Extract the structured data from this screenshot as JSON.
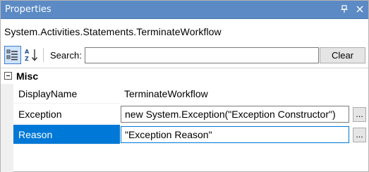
{
  "titlebar": {
    "title": "Properties",
    "pin_icon": "pin-icon",
    "close_icon": "close-icon"
  },
  "type_label": "System.Activities.Statements.TerminateWorkflow",
  "toolbar": {
    "categorized_icon": "categorized-view-icon",
    "alphabetical_icon": "sort-alphabetical-icon",
    "search_label": "Search:",
    "search_value": "",
    "clear_label": "Clear"
  },
  "grid": {
    "category": "Misc",
    "properties": [
      {
        "name": "DisplayName",
        "value": "TerminateWorkflow"
      },
      {
        "name": "Exception",
        "value": "new System.Exception(\"Exception Constructor\")",
        "ellipsis": "..."
      },
      {
        "name": "Reason",
        "value": "\"Exception Reason\"",
        "ellipsis": "..."
      }
    ],
    "selected_property": "Reason"
  },
  "colors": {
    "titlebar": "#5b8ac4",
    "selection": "#0078d7"
  }
}
